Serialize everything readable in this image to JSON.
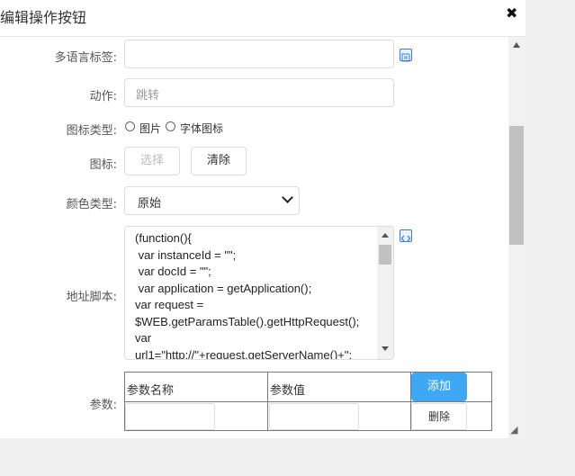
{
  "dialog": {
    "title": "编辑操作按钮"
  },
  "form": {
    "i18n_label": "多语言标签:",
    "i18n_value": "",
    "action_label": "动作:",
    "action_placeholder": "跳转",
    "icon_type_label": "图标类型:",
    "icon_type_options": [
      "图片",
      "字体图标"
    ],
    "icon_label": "图标:",
    "icon_select_button": "选择",
    "icon_clear_button": "清除",
    "color_type_label": "颜色类型:",
    "color_type_value": "原始",
    "script_label": "地址脚本:",
    "script_text": "(function(){\n var instanceId = \"\";\n var docId = \"\";\n var application = getApplication();\nvar request =\n$WEB.getParamsTable().getHttpRequest();\nvar\nurl1=\"http://\"+request.getServerName()+\":",
    "params_label": "参数:",
    "params_table": {
      "columns": [
        "参数名称",
        "参数值"
      ],
      "add_button": "添加",
      "delete_button": "删除"
    }
  },
  "icons": {
    "close": "close-icon",
    "i18n_edit": "edit-note-icon",
    "script_edit": "code-edit-icon"
  }
}
